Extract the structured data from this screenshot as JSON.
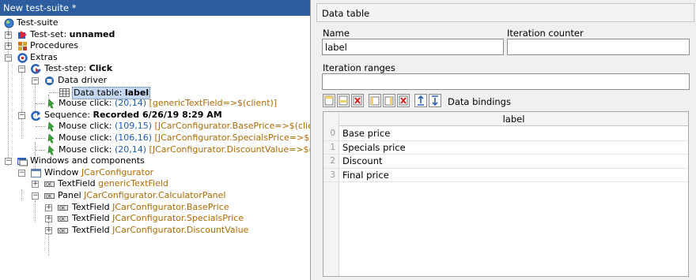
{
  "tree": {
    "title": "New test-suite *",
    "nodes": {
      "suite": "Test-suite",
      "testset_prefix": "Test-set: ",
      "testset_name": "unnamed",
      "procedures": "Procedures",
      "extras": "Extras",
      "teststep_prefix": "Test-step: ",
      "teststep_name": "Click",
      "data_driver": "Data driver",
      "data_table": "Data table: ",
      "data_table_name": "label",
      "mouse1_a": "Mouse click: ",
      "mouse1_b": "(20,14)",
      "mouse1_c": " [genericTextField=>$(client)]",
      "sequence_prefix": "Sequence: ",
      "sequence_name": "Recorded 6/26/19 8:29 AM",
      "mouse2_a": "Mouse click: ",
      "mouse2_b": "(109,15)",
      "mouse2_c": " [JCarConfigurator.BasePrice=>$(client",
      "mouse3_a": "Mouse click: ",
      "mouse3_b": "(106,16)",
      "mouse3_c": " [JCarConfigurator.SpecialsPrice=>$(cli",
      "mouse4_a": "Mouse click: ",
      "mouse4_b": "(20,14)",
      "mouse4_c": " [JCarConfigurator.DiscountValue=>$(cl",
      "windows": "Windows and components",
      "window_prefix": "Window ",
      "window_name": "JCarConfigurator",
      "tf1_prefix": "TextField ",
      "tf1_name": "genericTextField",
      "panel_prefix": "Panel ",
      "panel_name": "JCarConfigurator.CalculatorPanel",
      "tf2_prefix": "TextField ",
      "tf2_name": "JCarConfigurator.BasePrice",
      "tf3_prefix": "TextField ",
      "tf3_name": "JCarConfigurator.SpecialsPrice",
      "tf4_prefix": "TextField ",
      "tf4_name": "JCarConfigurator.DiscountValue"
    }
  },
  "panel": {
    "title": "Data table",
    "name_label": "Name",
    "name_value": "label",
    "iteration_counter_label": "Iteration counter",
    "iteration_counter_value": "",
    "iteration_ranges_label": "Iteration ranges",
    "iteration_ranges_value": "",
    "bindings_label": "Data bindings",
    "table": {
      "column": "label",
      "rows": [
        {
          "index": "0",
          "value": "Base price"
        },
        {
          "index": "1",
          "value": "Specials price"
        },
        {
          "index": "2",
          "value": "Discount"
        },
        {
          "index": "3",
          "value": "Final price"
        }
      ]
    }
  },
  "icons": [
    "suite-icon",
    "testset-icon",
    "procedures-icon",
    "extras-icon",
    "teststep-icon",
    "data-driver-icon",
    "data-table-icon",
    "mouse-click-icon",
    "sequence-icon",
    "windows-icon",
    "window-icon",
    "textfield-icon",
    "panel-icon",
    "insert-row-icon",
    "insert-row-after-icon",
    "delete-row-icon",
    "insert-column-icon",
    "edit-column-icon",
    "delete-column-icon",
    "move-up-icon",
    "move-down-icon"
  ],
  "colors": {
    "header_bg": "#2d5d9f",
    "link_blue": "#1a5fb4",
    "component_orange": "#b06a00",
    "selection": "#c5d7f0"
  }
}
